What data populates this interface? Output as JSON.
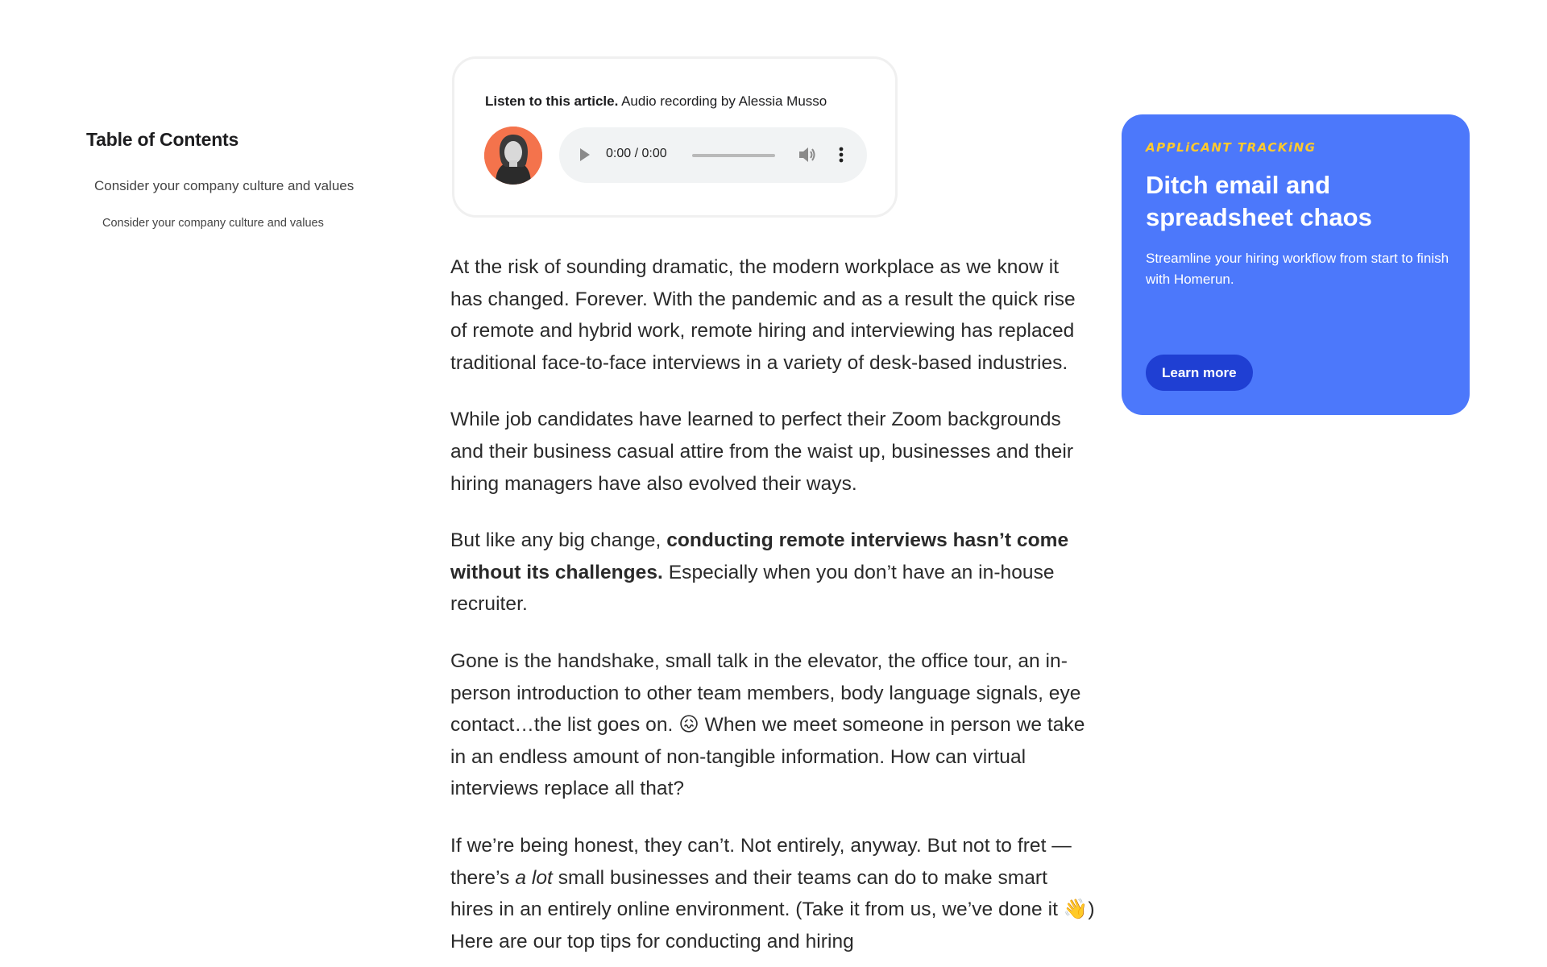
{
  "toc": {
    "title": "Table of Contents",
    "items": [
      "Consider your company culture and values",
      "Consider your company culture and values"
    ]
  },
  "audio": {
    "label_bold": "Listen to this article.",
    "label_rest": " Audio recording by Alessia Musso",
    "time": "0:00 / 0:00",
    "icons": [
      "play-icon",
      "volume-icon",
      "more-vert-icon"
    ]
  },
  "article": {
    "p1": "At the risk of sounding dramatic, the modern workplace as we know it has changed. Forever. With the pandemic and as a result the quick rise of remote and hybrid work, remote hiring and interviewing has replaced traditional face-to-face interviews in a variety of desk-based industries.",
    "p2": "While job candidates have learned to perfect their Zoom backgrounds and their business casual attire from the waist up, businesses and their hiring managers have also evolved their ways.",
    "p3_a": "But like any big change, ",
    "p3_b": "conducting remote interviews hasn’t come without its challenges.",
    "p3_c": " Especially when you don’t have an in-house recruiter.",
    "p4_a": "Gone is the handshake, small talk in the elevator, the office tour, an in-person introduction to other team members, body language signals, eye contact…the list goes on. ",
    "p4_emoji": "😖",
    "p4_b": " When we meet someone in person we take in an endless amount of non-tangible information. How can virtual interviews replace all that?",
    "p5_a": "If we’re being honest, they can’t. Not entirely, anyway. But not to fret — there’s ",
    "p5_em": "a lot",
    "p5_b": " small businesses and their teams can do to make smart hires in an entirely online environment. (Take it from us, we’ve done it 👋) Here are our top tips for conducting and hiring"
  },
  "promo": {
    "kicker": "APPLiCANT TRACKiNG",
    "title": "Ditch email and spreadsheet chaos",
    "subtitle": "Streamline your hiring workflow from start to finish with Homerun.",
    "button": "Learn more",
    "bg_color": "#4c78fb",
    "kicker_color": "#ffc92f",
    "button_color": "#1f3fd3"
  }
}
